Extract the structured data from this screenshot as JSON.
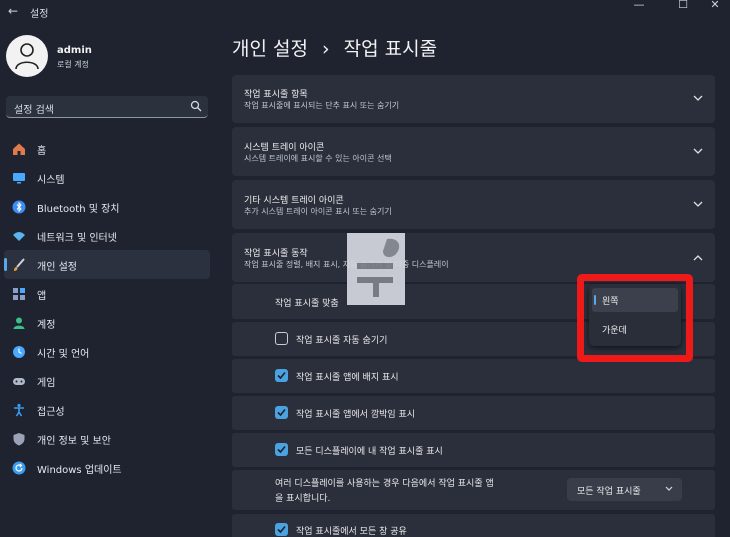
{
  "window": {
    "title": "설정",
    "back_glyph": "←",
    "minimize_glyph": "—",
    "maximize_glyph": "☐",
    "close_glyph": "✕"
  },
  "user": {
    "name": "admin",
    "account_type": "로컬 계정"
  },
  "search": {
    "placeholder": "설정 검색"
  },
  "nav": [
    {
      "label": "홈",
      "icon": "home-icon",
      "color": "#e07a4a",
      "active": false
    },
    {
      "label": "시스템",
      "icon": "monitor-icon",
      "color": "#4aa8ff",
      "active": false
    },
    {
      "label": "Bluetooth 및 장치",
      "icon": "bluetooth-icon",
      "color": "#3b8ff0",
      "active": false
    },
    {
      "label": "네트워크 및 인터넷",
      "icon": "wifi-icon",
      "color": "#5ab4f0",
      "active": false
    },
    {
      "label": "개인 설정",
      "icon": "brush-icon",
      "color": "#e8a040",
      "active": true
    },
    {
      "label": "앱",
      "icon": "apps-icon",
      "color": "#8aa0c8",
      "active": false
    },
    {
      "label": "계정",
      "icon": "person-icon",
      "color": "#3cc08a",
      "active": false
    },
    {
      "label": "시간 및 언어",
      "icon": "globe-clock-icon",
      "color": "#4aa8ff",
      "active": false
    },
    {
      "label": "게임",
      "icon": "gamepad-icon",
      "color": "#b0b8c8",
      "active": false
    },
    {
      "label": "접근성",
      "icon": "accessibility-icon",
      "color": "#3b9cf0",
      "active": false
    },
    {
      "label": "개인 정보 및 보안",
      "icon": "shield-icon",
      "color": "#9aa3b5",
      "active": false
    },
    {
      "label": "Windows 업데이트",
      "icon": "update-icon",
      "color": "#3b9cf0",
      "active": false
    }
  ],
  "breadcrumb": {
    "parent": "개인 설정",
    "separator": "›",
    "current": "작업 표시줄"
  },
  "sections": [
    {
      "title": "작업 표시줄 항목",
      "subtitle": "작업 표시줄에 표시되는 단추 표시 또는 숨기기",
      "expanded": false
    },
    {
      "title": "시스템 트레이 아이콘",
      "subtitle": "시스템 트레이에 표시할 수 있는 아이콘 선택",
      "expanded": false
    },
    {
      "title": "기타 시스템 트레이 아이콘",
      "subtitle": "추가 시스템 트레이 아이콘 표시 또는 숨기기",
      "expanded": false
    },
    {
      "title": "작업 표시줄 동작",
      "subtitle": "작업 표시줄 정렬, 배지 표시, 자동 숨기기 및 다중 디스플레이",
      "expanded": true
    }
  ],
  "behaviors": {
    "alignment_label": "작업 표시줄 맞춤",
    "alignment_options": [
      "왼쪽",
      "가운데"
    ],
    "alignment_selected": "왼쪽",
    "checkboxes": [
      {
        "label": "작업 표시줄 자동 숨기기",
        "checked": false
      },
      {
        "label": "작업 표시줄 앱에 배지 표시",
        "checked": true
      },
      {
        "label": "작업 표시줄 앱에서 깜박임 표시",
        "checked": true
      },
      {
        "label": "모든 디스플레이에 내 작업 표시줄 표시",
        "checked": true
      }
    ],
    "multi_display_label_line1": "여러 디스플레이를 사용하는 경우 다음에서 작업 표시줄 앱",
    "multi_display_label_line2": "을 표시합니다.",
    "multi_display_value": "모든 작업 표시줄",
    "share_label": "작업 표시줄에서 모든 창 공유",
    "share_checked": true
  },
  "colors": {
    "accent": "#4aa3e0",
    "highlight": "#ee1a1a",
    "background": "#1f2330",
    "card": "#2b2f3b"
  }
}
